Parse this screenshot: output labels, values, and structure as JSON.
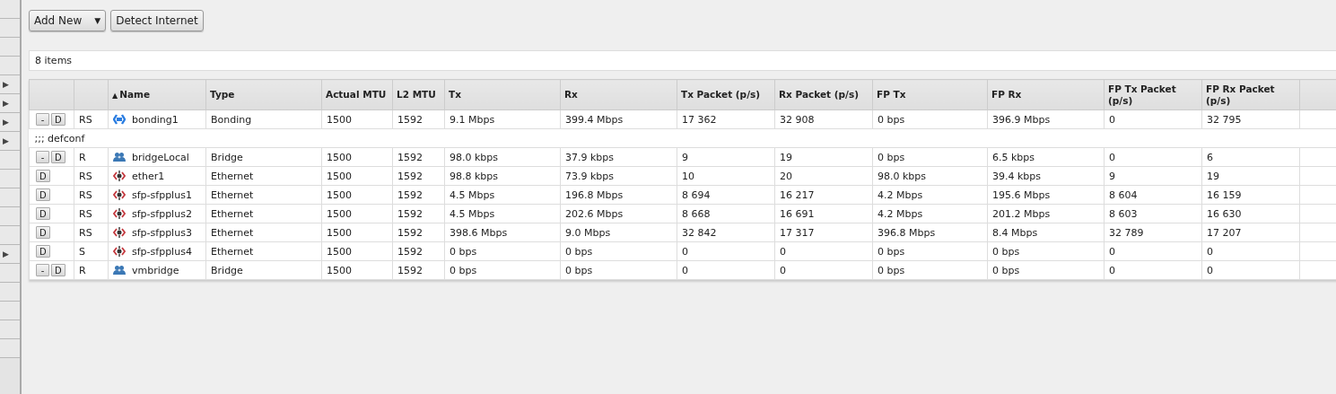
{
  "sidebar": {
    "items": [
      {
        "kind": "blank"
      },
      {
        "kind": "blank"
      },
      {
        "kind": "blank"
      },
      {
        "kind": "blank"
      },
      {
        "kind": "arrow",
        "arrow": "▶"
      },
      {
        "kind": "arrow",
        "arrow": "▶"
      },
      {
        "kind": "arrow",
        "arrow": "▶"
      },
      {
        "kind": "arrow",
        "arrow": "▶"
      },
      {
        "kind": "blank"
      },
      {
        "kind": "blank"
      },
      {
        "kind": "blank"
      },
      {
        "kind": "blank"
      },
      {
        "kind": "blank"
      },
      {
        "kind": "arrow",
        "arrow": "▶"
      },
      {
        "kind": "blank"
      },
      {
        "kind": "blank"
      },
      {
        "kind": "blank"
      },
      {
        "kind": "blank"
      },
      {
        "kind": "blank"
      }
    ]
  },
  "toolbar": {
    "add_button": {
      "label": "Add New",
      "caret": "▼"
    },
    "buttons": [
      "Detect Internet"
    ]
  },
  "item_count": "8 items",
  "table": {
    "columns": [
      {},
      {},
      {
        "label": "Name",
        "sort": "▲"
      },
      {
        "label": "Type"
      },
      {
        "label": "Actual MTU"
      },
      {
        "label": "L2 MTU"
      },
      {
        "label": "Tx"
      },
      {
        "label": "Rx"
      },
      {
        "label": "Tx Packet (p/s)"
      },
      {
        "label": "Rx Packet (p/s)"
      },
      {
        "label": "FP Tx"
      },
      {
        "label": "FP Rx"
      },
      {
        "label": "FP Tx Packet (p/s)"
      },
      {
        "label": "FP Rx Packet (p/s)"
      },
      {}
    ],
    "rows": [
      {
        "kind": "bonding",
        "actions": [
          "-",
          "D"
        ],
        "flags": "RS",
        "cells": [
          "bonding1",
          "Bonding",
          "1500",
          "1592",
          "9.1 Mbps",
          "399.4 Mbps",
          "17 362",
          "32 908",
          "0 bps",
          "396.9 Mbps",
          "0",
          "32 795"
        ]
      },
      {
        "kind": "comment",
        "text": ";;; defconf"
      },
      {
        "kind": "bridge",
        "actions": [
          "-",
          "D"
        ],
        "flags": "R",
        "cells": [
          "bridgeLocal",
          "Bridge",
          "1500",
          "1592",
          "98.0 kbps",
          "37.9 kbps",
          "9",
          "19",
          "0 bps",
          "6.5 kbps",
          "0",
          "6"
        ]
      },
      {
        "kind": "ethernet",
        "actions": [
          "D"
        ],
        "flags": "RS",
        "cells": [
          "ether1",
          "Ethernet",
          "1500",
          "1592",
          "98.8 kbps",
          "73.9 kbps",
          "10",
          "20",
          "98.0 kbps",
          "39.4 kbps",
          "9",
          "19"
        ]
      },
      {
        "kind": "ethernet",
        "actions": [
          "D"
        ],
        "flags": "RS",
        "cells": [
          "sfp-sfpplus1",
          "Ethernet",
          "1500",
          "1592",
          "4.5 Mbps",
          "196.8 Mbps",
          "8 694",
          "16 217",
          "4.2 Mbps",
          "195.6 Mbps",
          "8 604",
          "16 159"
        ]
      },
      {
        "kind": "ethernet",
        "actions": [
          "D"
        ],
        "flags": "RS",
        "cells": [
          "sfp-sfpplus2",
          "Ethernet",
          "1500",
          "1592",
          "4.5 Mbps",
          "202.6 Mbps",
          "8 668",
          "16 691",
          "4.2 Mbps",
          "201.2 Mbps",
          "8 603",
          "16 630"
        ]
      },
      {
        "kind": "ethernet",
        "actions": [
          "D"
        ],
        "flags": "RS",
        "cells": [
          "sfp-sfpplus3",
          "Ethernet",
          "1500",
          "1592",
          "398.6 Mbps",
          "9.0 Mbps",
          "32 842",
          "17 317",
          "396.8 Mbps",
          "8.4 Mbps",
          "32 789",
          "17 207"
        ]
      },
      {
        "kind": "ethernet",
        "actions": [
          "D"
        ],
        "flags": "S",
        "cells": [
          "sfp-sfpplus4",
          "Ethernet",
          "1500",
          "1592",
          "0 bps",
          "0 bps",
          "0",
          "0",
          "0 bps",
          "0 bps",
          "0",
          "0"
        ]
      },
      {
        "kind": "bridge",
        "actions": [
          "-",
          "D"
        ],
        "flags": "R",
        "cells": [
          "vmbridge",
          "Bridge",
          "1500",
          "1592",
          "0 bps",
          "0 bps",
          "0",
          "0",
          "0 bps",
          "0 bps",
          "0",
          "0"
        ]
      }
    ]
  }
}
